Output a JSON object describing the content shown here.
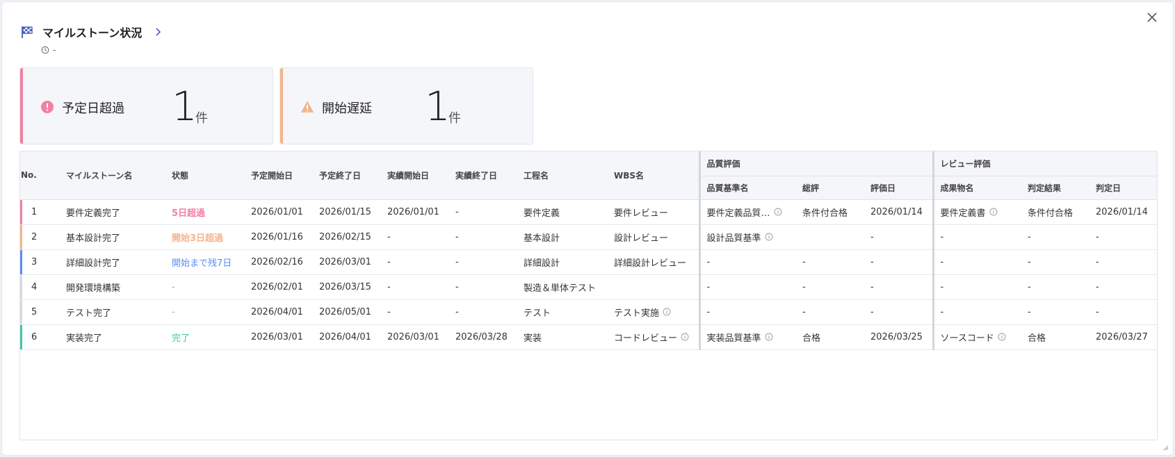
{
  "header": {
    "title": "マイルストーン状況",
    "updated": "-"
  },
  "cards": {
    "overdue": {
      "label": "予定日超過",
      "count": "1",
      "unit": "件"
    },
    "delay": {
      "label": "開始遅延",
      "count": "1",
      "unit": "件"
    }
  },
  "table": {
    "groups": {
      "quality": "品質評価",
      "review": "レビュー評価"
    },
    "headers": {
      "no": "No.",
      "name": "マイルストーン名",
      "status": "状態",
      "plan_start": "予定開始日",
      "plan_end": "予定終了日",
      "actual_start": "実績開始日",
      "actual_end": "実績終了日",
      "process": "工程名",
      "wbs": "WBS名",
      "q_standard": "品質基準名",
      "q_overall": "総評",
      "q_date": "評価日",
      "r_deliverable": "成果物名",
      "r_result": "判定結果",
      "r_date": "判定日"
    },
    "rows": [
      {
        "no": "1",
        "name": "要件定義完了",
        "status": "5日超過",
        "plan_start": "2026/01/01",
        "plan_end": "2026/01/15",
        "actual_start": "2026/01/01",
        "actual_end": "-",
        "process": "要件定義",
        "wbs": "要件レビュー",
        "q_standard": "要件定義品質…",
        "q_overall": "条件付合格",
        "q_date": "2026/01/14",
        "r_deliverable": "要件定義書",
        "r_result": "条件付合格",
        "r_date": "2026/01/14"
      },
      {
        "no": "2",
        "name": "基本設計完了",
        "status": "開始3日超過",
        "plan_start": "2026/01/16",
        "plan_end": "2026/02/15",
        "actual_start": "-",
        "actual_end": "-",
        "process": "基本設計",
        "wbs": "設計レビュー",
        "q_standard": "設計品質基準",
        "q_overall": "",
        "q_date": "-",
        "r_deliverable": "-",
        "r_result": "-",
        "r_date": "-"
      },
      {
        "no": "3",
        "name": "詳細設計完了",
        "status": "開始まで残7日",
        "plan_start": "2026/02/16",
        "plan_end": "2026/03/01",
        "actual_start": "-",
        "actual_end": "-",
        "process": "詳細設計",
        "wbs": "詳細設計レビュー",
        "q_standard": "-",
        "q_overall": "-",
        "q_date": "-",
        "r_deliverable": "-",
        "r_result": "-",
        "r_date": "-"
      },
      {
        "no": "4",
        "name": "開発環境構築",
        "status": "-",
        "plan_start": "2026/02/01",
        "plan_end": "2026/03/15",
        "actual_start": "-",
        "actual_end": "-",
        "process": "製造＆単体テスト",
        "wbs": "",
        "q_standard": "-",
        "q_overall": "-",
        "q_date": "-",
        "r_deliverable": "-",
        "r_result": "-",
        "r_date": "-"
      },
      {
        "no": "5",
        "name": "テスト完了",
        "status": "-",
        "plan_start": "2026/04/01",
        "plan_end": "2026/05/01",
        "actual_start": "-",
        "actual_end": "-",
        "process": "テスト",
        "wbs": "テスト実施",
        "q_standard": "-",
        "q_overall": "-",
        "q_date": "-",
        "r_deliverable": "-",
        "r_result": "-",
        "r_date": "-"
      },
      {
        "no": "6",
        "name": "実装完了",
        "status": "完了",
        "plan_start": "2026/03/01",
        "plan_end": "2026/04/01",
        "actual_start": "2026/03/01",
        "actual_end": "2026/03/28",
        "process": "実装",
        "wbs": "コードレビュー",
        "q_standard": "実装品質基準",
        "q_overall": "合格",
        "q_date": "2026/03/25",
        "r_deliverable": "ソースコード",
        "r_result": "合格",
        "r_date": "2026/03/27"
      }
    ]
  },
  "colors": {
    "overdue": "#f081a3",
    "delay": "#f5b48d",
    "upcoming": "#5b8def",
    "done": "#3ec7a5",
    "neutral": "#d8dbe1",
    "accent_flag": "#4a5fc1"
  }
}
